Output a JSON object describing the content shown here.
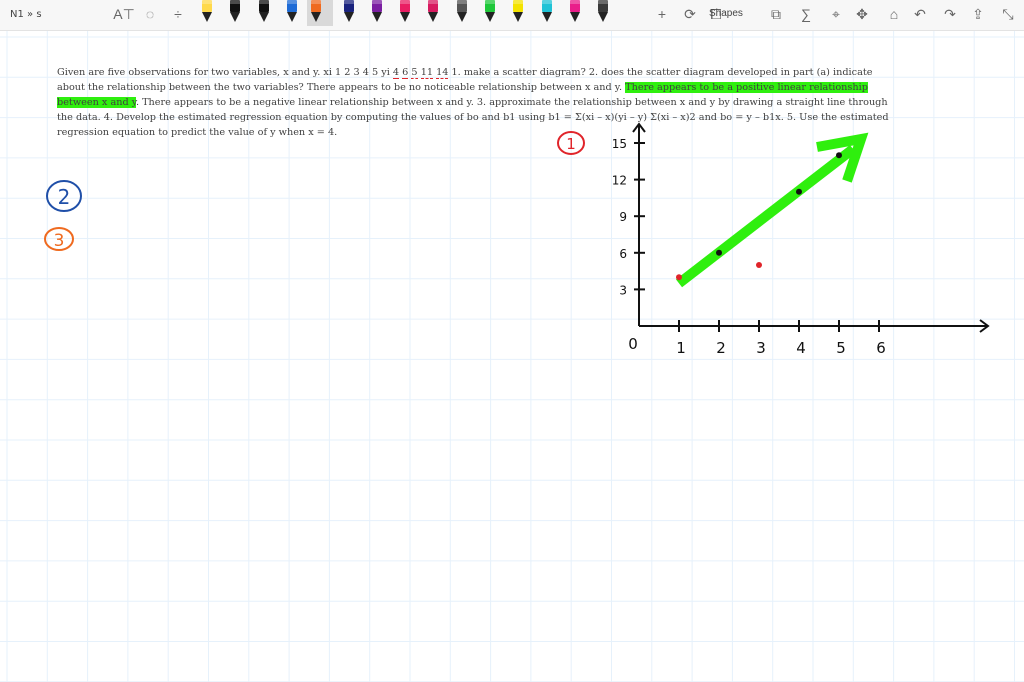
{
  "window": {
    "title": "N1 » s"
  },
  "toolbar": {
    "tools": [
      {
        "name": "insert-text-icon",
        "glyph": "A⊤"
      },
      {
        "name": "lasso-select-icon",
        "glyph": "◌"
      },
      {
        "name": "add-space-icon",
        "glyph": "÷"
      },
      {
        "name": "add-pen-icon",
        "glyph": "+"
      },
      {
        "name": "ink-to-shape-icon",
        "glyph": "⟳"
      }
    ],
    "pens": [
      {
        "color": "#ffd94a"
      },
      {
        "color": "#111111"
      },
      {
        "color": "#111111"
      },
      {
        "color": "#1e6bd6"
      },
      {
        "color": "#ef6a1f"
      },
      {
        "color": "#1a237e"
      },
      {
        "color": "#7b1fa2"
      },
      {
        "color": "#e91e63"
      },
      {
        "color": "#d81b60"
      },
      {
        "color": "#555555"
      },
      {
        "color": "#1fc83a"
      },
      {
        "color": "#f4e300"
      },
      {
        "color": "#20c3d6"
      },
      {
        "color": "#e91e8a"
      },
      {
        "color": "#3a3a3a"
      }
    ],
    "shapes_label": "Shapes",
    "right_tools": [
      {
        "name": "lasso-icon",
        "glyph": "⧉"
      },
      {
        "name": "ink-to-math-icon",
        "glyph": "∑"
      },
      {
        "name": "ruler-icon",
        "glyph": "⌖"
      },
      {
        "name": "replay-icon",
        "glyph": "✥"
      },
      {
        "name": "ink-to-text-icon",
        "glyph": "⌂"
      },
      {
        "name": "undo-icon",
        "glyph": "↶"
      },
      {
        "name": "redo-icon",
        "glyph": "↷"
      },
      {
        "name": "share-icon",
        "glyph": "⇪"
      },
      {
        "name": "fullscreen-icon",
        "glyph": "⤡"
      }
    ]
  },
  "question": {
    "p1": "Given are five observations for two variables, x and y. xi 1 2 3 4 5 yi ",
    "yvals": [
      "4",
      "6",
      "5",
      "11",
      "14"
    ],
    "p2": " 1. make a scatter diagram? 2. does the scatter diagram developed in part (a) indicate about the relationship between the two variables? There appears to be no noticeable relationship between x and y. ",
    "highlight": "There appears to be a positive linear relationship between x and y",
    "p3": ". There appears to be a negative linear relationship between x and y. 3. approximate the relationship between x and y by drawing a straight line through the data. 4. Develop the estimated regression equation by computing the values of bo and b1 using b1 = Σ(xi – x)(yi – y) Σ(xi – x)2 and bo = y – b1x. 5. Use the estimated regression equation to predict the value of y when x = 4."
  },
  "annotations": {
    "circle1": {
      "text": "1",
      "color": "#e0242a"
    },
    "circle2": {
      "text": "2",
      "color": "#1f4fa8"
    },
    "circle3": {
      "text": "3",
      "color": "#ef6a1f"
    }
  },
  "chart_data": {
    "type": "scatter",
    "x_ticks": [
      "1",
      "2",
      "3",
      "4",
      "5",
      "6"
    ],
    "y_ticks": [
      "3",
      "6",
      "9",
      "12",
      "15"
    ],
    "origin_label": "0",
    "xlim": [
      0,
      6.5
    ],
    "ylim": [
      0,
      15
    ],
    "points": [
      {
        "x": 1,
        "y": 4,
        "color": "#e0242a"
      },
      {
        "x": 2,
        "y": 6,
        "color": "#111111"
      },
      {
        "x": 3,
        "y": 5,
        "color": "#e0242a"
      },
      {
        "x": 4,
        "y": 11,
        "color": "#111111"
      },
      {
        "x": 5,
        "y": 14,
        "color": "#111111"
      }
    ],
    "trend_line": {
      "from": [
        1,
        3.5
      ],
      "to": [
        5.5,
        15
      ],
      "color": "#2fef0e"
    }
  }
}
